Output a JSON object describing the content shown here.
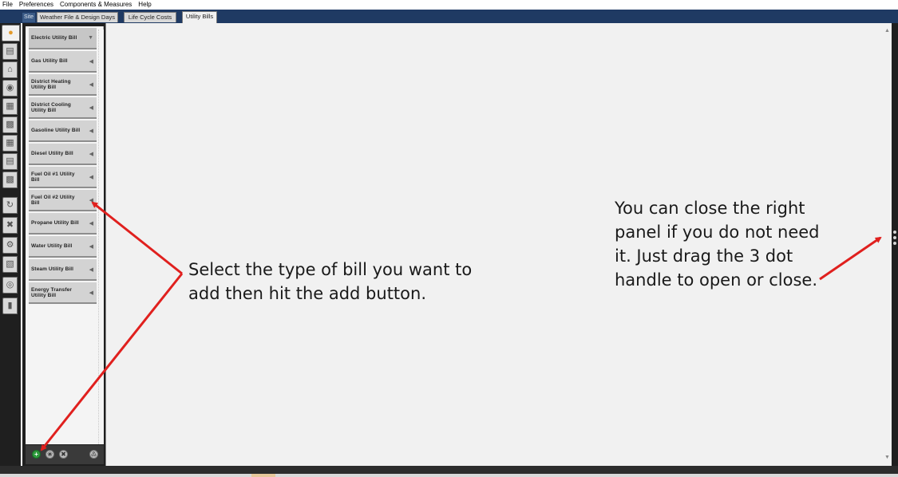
{
  "menu": [
    "File",
    "Preferences",
    "Components & Measures",
    "Help"
  ],
  "tabs": [
    {
      "label": "Site",
      "active": false
    },
    {
      "label": "Weather File & Design Days",
      "active": false
    },
    {
      "label": "Life Cycle Costs",
      "active": false
    },
    {
      "label": "Utility Bills",
      "active": true
    }
  ],
  "left_nav_icons": [
    "home-icon",
    "building-icon",
    "house-icon",
    "sphere-icon",
    "cube-icon",
    "spaces-icon",
    "thermal-zone-icon",
    "stack-icon",
    "layers-icon",
    "loop-icon",
    "tools-icon",
    "gear-icon",
    "cube-split-icon",
    "globe-icon",
    "bar-chart-icon"
  ],
  "bills": [
    "Electric Utility Bill",
    "Gas Utility Bill",
    "District Heating Utility Bill",
    "District Cooling Utility Bill",
    "Gasoline Utility Bill",
    "Diesel Utility Bill",
    "Fuel Oil #1 Utility Bill",
    "Fuel Oil #2 Utility Bill",
    "Propane Utility Bill",
    "Water Utility Bill",
    "Steam Utility Bill",
    "Energy Transfer Utility Bill"
  ],
  "selected_bill_index": 0,
  "bottom_buttons": {
    "add": "+",
    "copy": "❀",
    "remove": "✖",
    "purge": "♳"
  },
  "annotations": {
    "left": [
      "Select the type of bill you want to",
      "add then hit the add button."
    ],
    "right": [
      "You can close the right",
      "panel if you do not need",
      "it. Just drag the 3 dot",
      "handle to open or close."
    ]
  },
  "colors": {
    "accent_arrow": "#e0201e",
    "tab_band": "#1f3a63",
    "add_button": "#2e9b3c"
  }
}
